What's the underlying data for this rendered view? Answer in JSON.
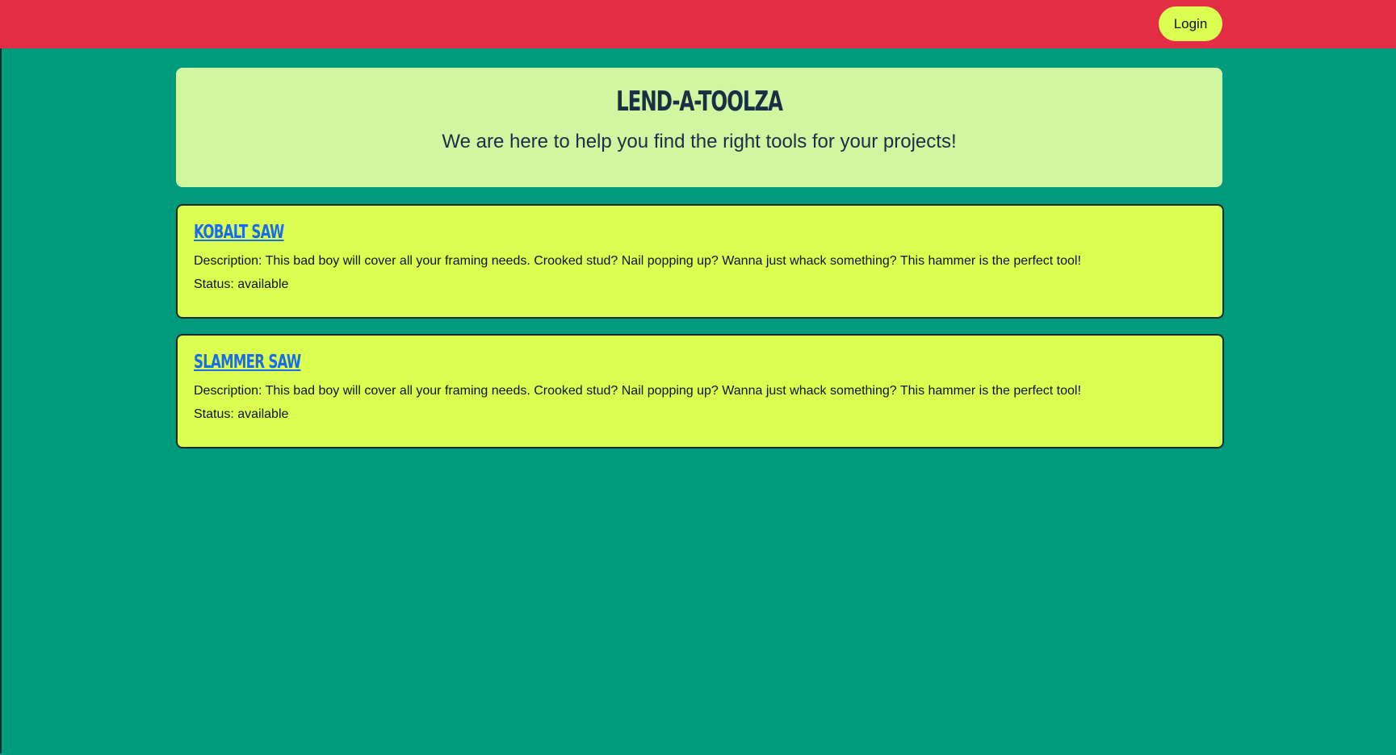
{
  "header": {
    "login_label": "Login"
  },
  "hero": {
    "title": "LEND-A-TOOLZA",
    "subtitle": "We are here to help you find the right tools for your projects!"
  },
  "tools": [
    {
      "name": "KOBALT SAW",
      "description": "Description: This bad boy will cover all your framing needs. Crooked stud? Nail popping up? Wanna just whack something? This hammer is the perfect tool!",
      "status": "Status: available"
    },
    {
      "name": "SLAMMER SAW",
      "description": "Description: This bad boy will cover all your framing needs. Crooked stud? Nail popping up? Wanna just whack something? This hammer is the perfect tool!",
      "status": "Status: available"
    }
  ],
  "colors": {
    "header_bg": "#e32d45",
    "page_bg": "#009b7d",
    "hero_bg": "#d0f6a2",
    "card_bg": "#daff50",
    "link": "#1a6bf0"
  }
}
